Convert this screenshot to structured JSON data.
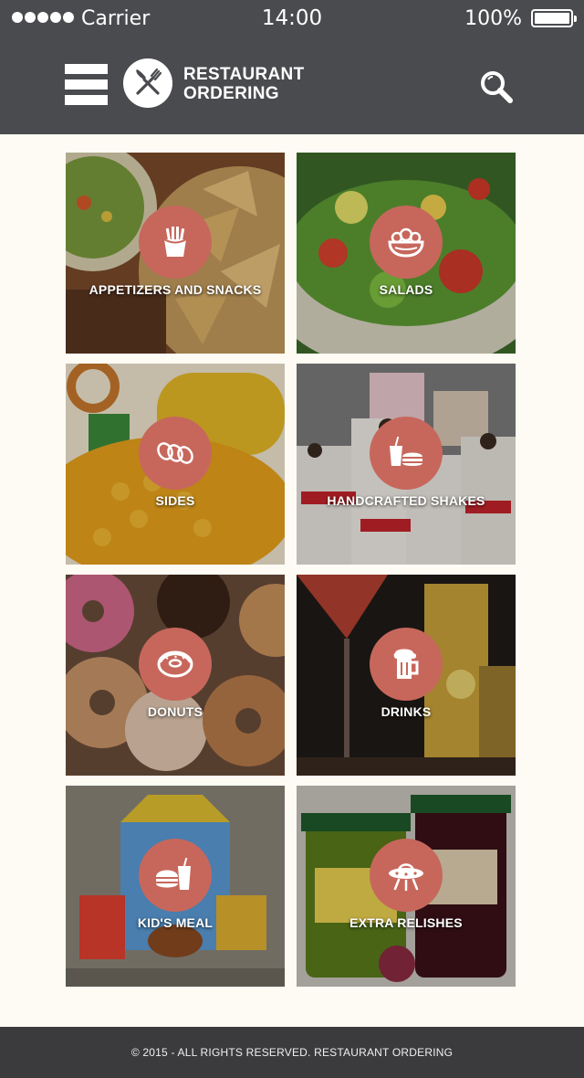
{
  "status_bar": {
    "carrier": "Carrier",
    "time": "14:00",
    "battery": "100%"
  },
  "header": {
    "brand_line1": "RESTAURANT",
    "brand_line2": "ORDERING",
    "menu_icon": "hamburger-menu-icon",
    "logo_icon": "fork-knife-icon",
    "search_icon": "search-icon",
    "bar_color": "#4a4b4e"
  },
  "categories": [
    {
      "label": "APPETIZERS AND SNACKS",
      "icon": "fries-icon"
    },
    {
      "label": "SALADS",
      "icon": "salad-bowl-icon"
    },
    {
      "label": "SIDES",
      "icon": "onion-rings-icon"
    },
    {
      "label": "HANDCRAFTED SHAKES",
      "icon": "drink-burger-icon"
    },
    {
      "label": "DONUTS",
      "icon": "donut-icon"
    },
    {
      "label": "DRINKS",
      "icon": "beer-mug-icon"
    },
    {
      "label": "KID'S MEAL",
      "icon": "burger-drink-icon"
    },
    {
      "label": "EXTRA RELISHES",
      "icon": "ufo-icon"
    }
  ],
  "accent_color": "#c7675c",
  "footer": {
    "text": "© 2015  -  ALL RIGHTS RESERVED. RESTAURANT ORDERING"
  }
}
